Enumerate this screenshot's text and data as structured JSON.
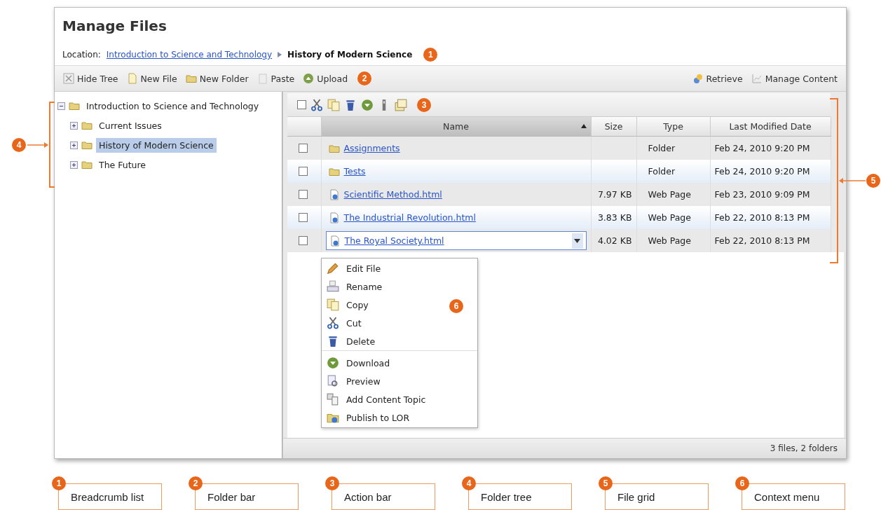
{
  "page_title": "Manage Files",
  "breadcrumb": {
    "label": "Location:",
    "items": [
      {
        "text": "Introduction to Science and Technology",
        "kind": "link"
      },
      {
        "text": "History of Modern Science",
        "kind": "current"
      }
    ],
    "marker": "1"
  },
  "folder_bar": {
    "left": [
      "Hide Tree",
      "New File",
      "New Folder",
      "Paste",
      "Upload"
    ],
    "right": [
      "Retrieve",
      "Manage Content"
    ],
    "marker": "2"
  },
  "tree": {
    "marker": "4",
    "items": [
      {
        "label": "Introduction to Science and Technology",
        "expanded": true,
        "selected": false,
        "children": [
          {
            "label": "Current Issues",
            "expanded": false,
            "selected": false
          },
          {
            "label": "History of Modern Science",
            "expanded": false,
            "selected": true
          },
          {
            "label": "The Future",
            "expanded": false,
            "selected": false
          }
        ]
      }
    ]
  },
  "action_bar": {
    "select_all": {
      "checked": false
    },
    "marker": "3"
  },
  "grid": {
    "marker": "5",
    "columns": [
      {
        "label": "Name",
        "sorted": true
      },
      {
        "label": "Size",
        "sorted": false
      },
      {
        "label": "Type",
        "sorted": false
      },
      {
        "label": "Last Modified Date",
        "sorted": false
      }
    ],
    "rows": [
      {
        "kind": "folder",
        "name": "Assignments",
        "size": "",
        "type": "Folder",
        "modified": "Feb 24, 2010 9:20 PM",
        "checked": false,
        "selected": false
      },
      {
        "kind": "folder",
        "name": "Tests",
        "size": "",
        "type": "Folder",
        "modified": "Feb 24, 2010 9:20 PM",
        "checked": false,
        "selected": false
      },
      {
        "kind": "page",
        "name": "Scientific Method.html",
        "size": "7.97 KB",
        "type": "Web Page",
        "modified": "Feb 23, 2010 9:09 PM",
        "checked": false,
        "selected": false
      },
      {
        "kind": "page",
        "name": "The Industrial Revolution.html",
        "size": "3.83 KB",
        "type": "Web Page",
        "modified": "Feb 22, 2010 8:13 PM",
        "checked": false,
        "selected": false
      },
      {
        "kind": "page",
        "name": "The Royal Society.html",
        "size": "4.02 KB",
        "type": "Web Page",
        "modified": "Feb 22, 2010 8:13 PM",
        "checked": false,
        "selected": true
      }
    ],
    "status": "3 files, 2 folders"
  },
  "context_menu": {
    "marker": "6",
    "groups": [
      [
        "Edit File",
        "Rename",
        "Copy",
        "Cut",
        "Delete"
      ],
      [
        "Download",
        "Preview",
        "Add Content Topic",
        "Publish to LOR"
      ]
    ]
  },
  "legend": [
    {
      "number": "1",
      "label": "Breadcrumb list"
    },
    {
      "number": "2",
      "label": "Folder bar"
    },
    {
      "number": "3",
      "label": "Action bar"
    },
    {
      "number": "4",
      "label": "Folder tree"
    },
    {
      "number": "5",
      "label": "File grid"
    },
    {
      "number": "6",
      "label": "Context menu"
    }
  ]
}
